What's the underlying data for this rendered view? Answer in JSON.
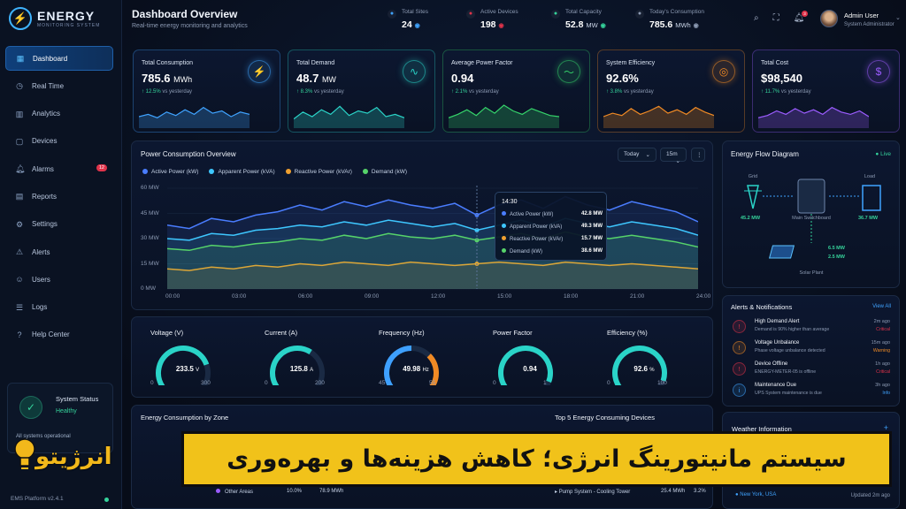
{
  "brand": {
    "title": "ENERGY",
    "subtitle": "MONITORING SYSTEM",
    "logo_icon": "lightning-icon"
  },
  "nav": [
    {
      "label": "Dashboard",
      "icon": "grid-icon",
      "glyph": "▦",
      "active": true
    },
    {
      "label": "Real Time",
      "icon": "clock-icon",
      "glyph": "◷"
    },
    {
      "label": "Analytics",
      "icon": "bar-chart-icon",
      "glyph": "▥"
    },
    {
      "label": "Devices",
      "icon": "device-icon",
      "glyph": "▢"
    },
    {
      "label": "Alarms",
      "icon": "bell-icon",
      "glyph": "🔔︎",
      "badge": "12"
    },
    {
      "label": "Reports",
      "icon": "report-icon",
      "glyph": "▤"
    },
    {
      "label": "Settings",
      "icon": "gear-icon",
      "glyph": "⚙"
    },
    {
      "label": "Alerts",
      "icon": "alert-icon",
      "glyph": "⚠"
    },
    {
      "label": "Users",
      "icon": "users-icon",
      "glyph": "☺"
    },
    {
      "label": "Logs",
      "icon": "log-icon",
      "glyph": "☰"
    },
    {
      "label": "Help Center",
      "icon": "help-icon",
      "glyph": "?"
    }
  ],
  "system_status": {
    "title": "System Status",
    "state": "Healthy",
    "sub": "All systems operational"
  },
  "version": "EMS Platform v2.4.1",
  "header": {
    "title": "Dashboard Overview",
    "subtitle": "Real-time energy monitoring and analytics"
  },
  "kpis": [
    {
      "label": "Total Sites",
      "value": "24",
      "unit": "",
      "icon": "location-icon",
      "color": "#3fa3ff"
    },
    {
      "label": "Active Devices",
      "value": "198",
      "unit": "",
      "icon": "activity-icon",
      "color": "#e0334a"
    },
    {
      "label": "Total Capacity",
      "value": "52.8",
      "unit": "MW",
      "icon": "capacity-icon",
      "color": "#35d39b"
    },
    {
      "label": "Today's Consumption",
      "value": "785.6",
      "unit": "MWh",
      "icon": "calendar-icon",
      "color": "#8c9ab3"
    }
  ],
  "user": {
    "name": "Admin User",
    "role": "System Administrator",
    "notif_count": "3"
  },
  "stat_cards": [
    {
      "label": "Total Consumption",
      "value": "785.6",
      "unit": "MWh",
      "delta": "↑ 12.5%",
      "delta_text": "vs yesterday",
      "color": "#3fa3ff",
      "icon": "lightning-icon",
      "glyph": "⚡"
    },
    {
      "label": "Total Demand",
      "value": "48.7",
      "unit": "MW",
      "delta": "↑ 8.3%",
      "delta_text": "vs yesterday",
      "color": "#2ad4c8",
      "icon": "pulse-icon",
      "glyph": "∿"
    },
    {
      "label": "Average Power Factor",
      "value": "0.94",
      "unit": "",
      "delta": "↑ 2.1%",
      "delta_text": "vs yesterday",
      "color": "#35d36a",
      "icon": "waveform-icon",
      "glyph": "〜"
    },
    {
      "label": "System Efficiency",
      "value": "92.6%",
      "unit": "",
      "delta": "↑ 3.8%",
      "delta_text": "vs yesterday",
      "color": "#f08a24",
      "icon": "target-icon",
      "glyph": "◎"
    },
    {
      "label": "Total Cost",
      "value": "$98,540",
      "unit": "",
      "delta": "↑ 11.7%",
      "delta_text": "vs yesterday",
      "color": "#9b5cff",
      "icon": "dollar-icon",
      "glyph": "$"
    }
  ],
  "power_chart": {
    "title": "Power Consumption Overview",
    "range_select": "Today",
    "interval_select": "15m",
    "tooltip": {
      "time": "14:30",
      "rows": [
        {
          "label": "Active Power (kW)",
          "value": "42.8 MW",
          "color": "#4a7dff"
        },
        {
          "label": "Apparent Power (kVA)",
          "value": "49.3 MW",
          "color": "#3ec7ff"
        },
        {
          "label": "Reactive Power (kVAr)",
          "value": "15.7 MW",
          "color": "#f0a030"
        },
        {
          "label": "Demand (kW)",
          "value": "38.6 MW",
          "color": "#56d36a"
        }
      ]
    }
  },
  "chart_data": {
    "type": "line",
    "x": [
      "00:00",
      "01:00",
      "02:00",
      "03:00",
      "04:00",
      "05:00",
      "06:00",
      "07:00",
      "08:00",
      "09:00",
      "10:00",
      "11:00",
      "12:00",
      "13:00",
      "14:00",
      "15:00",
      "16:00",
      "17:00",
      "18:00",
      "19:00",
      "20:00",
      "21:00",
      "22:00",
      "23:00",
      "24:00"
    ],
    "ylim": [
      0,
      60
    ],
    "yticks": [
      "60 MW",
      "45 MW",
      "30 MW",
      "15 MW",
      "0 MW"
    ],
    "xticks": [
      "00:00",
      "03:00",
      "06:00",
      "09:00",
      "12:00",
      "15:00",
      "18:00",
      "21:00",
      "24:00"
    ],
    "series": [
      {
        "name": "Active Power (kW)",
        "color": "#4a7dff",
        "values": [
          38,
          36,
          42,
          40,
          44,
          46,
          50,
          47,
          52,
          49,
          53,
          50,
          48,
          51,
          44,
          50,
          53,
          48,
          55,
          50,
          47,
          52,
          49,
          46,
          40
        ]
      },
      {
        "name": "Apparent Power (kVA)",
        "color": "#3ec7ff",
        "values": [
          30,
          29,
          33,
          32,
          35,
          36,
          38,
          37,
          40,
          38,
          41,
          39,
          37,
          39,
          35,
          38,
          41,
          37,
          42,
          39,
          37,
          40,
          38,
          36,
          32
        ]
      },
      {
        "name": "Reactive Power (kVAr)",
        "color": "#f0a030",
        "values": [
          12,
          11,
          13,
          12,
          14,
          13,
          15,
          14,
          16,
          15,
          14,
          16,
          15,
          14,
          15,
          16,
          15,
          14,
          16,
          15,
          14,
          15,
          14,
          13,
          12
        ]
      },
      {
        "name": "Demand (kW)",
        "color": "#56d36a",
        "values": [
          24,
          23,
          26,
          25,
          27,
          28,
          30,
          29,
          32,
          30,
          33,
          31,
          30,
          32,
          29,
          31,
          33,
          30,
          34,
          31,
          30,
          32,
          30,
          28,
          25
        ]
      }
    ]
  },
  "gauges": [
    {
      "title": "Voltage (V)",
      "value": "233.5",
      "unit": "V",
      "min": "0",
      "max": "300",
      "frac": 0.78,
      "color": "#2ad4c8"
    },
    {
      "title": "Current (A)",
      "value": "125.8",
      "unit": "A",
      "min": "0",
      "max": "200",
      "frac": 0.63,
      "color": "#2ad4c8"
    },
    {
      "title": "Frequency (Hz)",
      "value": "49.98",
      "unit": "Hz",
      "min": "45",
      "max": "55",
      "frac": 0.5,
      "color": "#3ea0ff"
    },
    {
      "title": "Power Factor",
      "value": "0.94",
      "unit": "",
      "min": "0",
      "max": "1",
      "frac": 0.94,
      "color": "#2ad4c8"
    },
    {
      "title": "Efficiency (%)",
      "value": "92.6",
      "unit": "%",
      "min": "0",
      "max": "100",
      "frac": 0.93,
      "color": "#2ad4c8"
    }
  ],
  "flow": {
    "title": "Energy Flow Diagram",
    "live": "Live",
    "grid": {
      "label": "Grid",
      "value": "45.2 MW"
    },
    "switchboard": {
      "label": "Main Switchboard"
    },
    "load": {
      "label": "Load",
      "value": "36.7 MW"
    },
    "solar": {
      "label": "Solar Plant",
      "value1": "6.5 MW",
      "value2": "2.5 MW"
    }
  },
  "alerts": {
    "title": "Alerts & Notifications",
    "view_all": "View All",
    "items": [
      {
        "name": "High Demand Alert",
        "desc": "Demand is 90% higher than average",
        "time": "2m ago",
        "tag": "Critical",
        "color": "#e0334a",
        "icon": "warning-icon"
      },
      {
        "name": "Voltage Unbalance",
        "desc": "Phase voltage unbalance detected",
        "time": "15m ago",
        "tag": "Warning",
        "color": "#f08a24",
        "icon": "warning-icon"
      },
      {
        "name": "Device Offline",
        "desc": "ENERGY-METER-05 is offline",
        "time": "1h ago",
        "tag": "Critical",
        "color": "#e0334a",
        "icon": "offline-icon"
      },
      {
        "name": "Maintenance Due",
        "desc": "UPS System maintenance is due",
        "time": "3h ago",
        "tag": "Info",
        "color": "#3fa3ff",
        "icon": "info-icon"
      }
    ]
  },
  "zone": {
    "title": "Energy Consumption by Zone",
    "row": {
      "name": "Other Areas",
      "pct": "10.0%",
      "value": "78.9 MWh"
    }
  },
  "top5": {
    "title": "Top 5 Energy Consuming Devices",
    "row": {
      "name": "Pump System - Cooling Tower",
      "value": "25.4 MWh",
      "pct": "3.2%"
    }
  },
  "weather": {
    "title": "Weather Information",
    "location": "New York, USA",
    "updated": "Updated 2m ago"
  },
  "banner": {
    "text": "سیستم مانیتورینگ انرژی؛ کاهش هزینه‌ها و بهره‌وری",
    "brand": "انرژیتو"
  }
}
